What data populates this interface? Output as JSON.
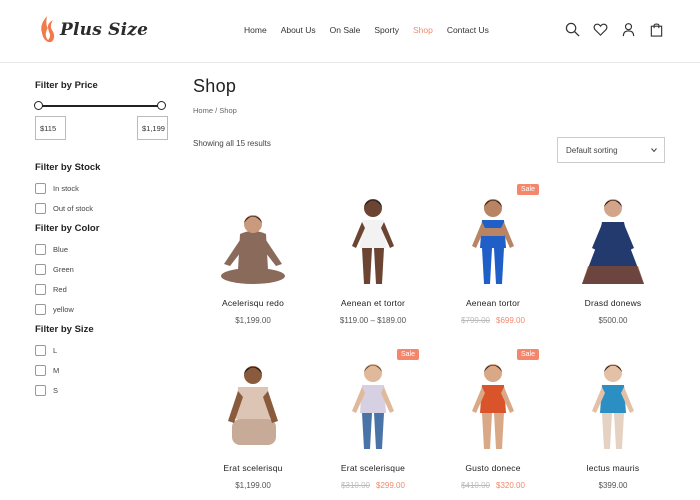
{
  "brand": {
    "name": "Plus Size"
  },
  "nav": [
    "Home",
    "About Us",
    "On Sale",
    "Sporty",
    "Shop",
    "Contact Us"
  ],
  "nav_active": "Shop",
  "header_icons": [
    "search-icon",
    "heart-icon",
    "user-icon",
    "bag-icon"
  ],
  "sidebar": {
    "price": {
      "title": "Filter by Price",
      "min": "$115",
      "max": "$1,199"
    },
    "stock": {
      "title": "Filter by Stock",
      "options": [
        "In stock",
        "Out of stock"
      ]
    },
    "color": {
      "title": "Filter by Color",
      "options": [
        "Blue",
        "Green",
        "Red",
        "yellow"
      ]
    },
    "size": {
      "title": "Filter by Size",
      "options": [
        "L",
        "M",
        "S"
      ]
    }
  },
  "main": {
    "title": "Shop",
    "breadcrumb": {
      "home": "Home",
      "sep": " / ",
      "current": "Shop"
    },
    "results": "Showing all 15 results",
    "sort": "Default sorting"
  },
  "sale_label": "Sale",
  "products": [
    {
      "name": "Acelerisqu redo",
      "price": "$1,199.00",
      "sale": false,
      "outfit": "#8a6a5a"
    },
    {
      "name": "Aenean et tortor",
      "price": "$119.00 – $189.00",
      "sale": false,
      "outfit": "#f2f2f2"
    },
    {
      "name": "Aenean tortor",
      "old_price": "$799.00",
      "price": "$699.00",
      "sale": true,
      "outfit": "#1f5fc7"
    },
    {
      "name": "Drasd donews",
      "price": "$500.00",
      "sale": false,
      "outfit": "#223a6e"
    },
    {
      "name": "Erat scelerisqu",
      "price": "$1,199.00",
      "sale": false,
      "outfit": "#dcc5b4"
    },
    {
      "name": "Erat scelerisque",
      "old_price": "$310.00",
      "price": "$299.00",
      "sale": true,
      "outfit": "#d6d0e2"
    },
    {
      "name": "Gusto donece",
      "old_price": "$410.00",
      "price": "$320.00",
      "sale": true,
      "outfit": "#d9532b"
    },
    {
      "name": "lectus mauris",
      "price": "$399.00",
      "sale": false,
      "outfit": "#2c8fc4"
    }
  ],
  "colors": {
    "accent": "#f08a6c",
    "sale_badge": "#f4866b",
    "text": "#222222"
  }
}
